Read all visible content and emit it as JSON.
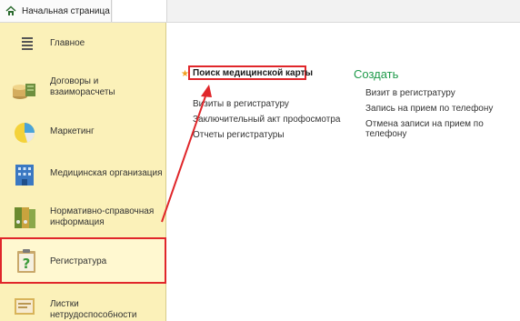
{
  "window": {
    "tab_label": "Начальная страница"
  },
  "sidebar": {
    "items": [
      {
        "label": "Главное"
      },
      {
        "label": "Договоры и",
        "label2": "взаиморасчеты"
      },
      {
        "label": "Маркетинг"
      },
      {
        "label": "Медицинская организация"
      },
      {
        "label": "Нормативно-справочная",
        "label2": "информация"
      },
      {
        "label": "Регистратура"
      },
      {
        "label": "Листки нетрудоспособности"
      }
    ]
  },
  "main": {
    "links": [
      {
        "label": "Поиск медицинской карты"
      },
      {
        "label": "Визиты в регистратуру"
      },
      {
        "label": "Заключительный акт профосмотра"
      },
      {
        "label": "Отчеты регистратуры"
      }
    ],
    "create": {
      "title": "Создать",
      "links": [
        {
          "label": "Визит в регистратуру"
        },
        {
          "label": "Запись на прием по телефону"
        },
        {
          "label": "Отмена записи на прием по телефону"
        }
      ]
    }
  },
  "colors": {
    "sidebar_bg": "#fbf1b9",
    "highlight": "#e0262a",
    "create_title": "#1e9a4a",
    "favorite_star": "#f0a020"
  },
  "icons": {
    "tab": "home-icon",
    "main": "menu-lines-icon",
    "contracts": "coins-icon",
    "marketing": "pie-chart-icon",
    "medorg": "building-icon",
    "nsi": "binders-icon",
    "registry": "clipboard-question-icon",
    "sick": "sick-leave-icon",
    "favorite": "star-icon"
  }
}
